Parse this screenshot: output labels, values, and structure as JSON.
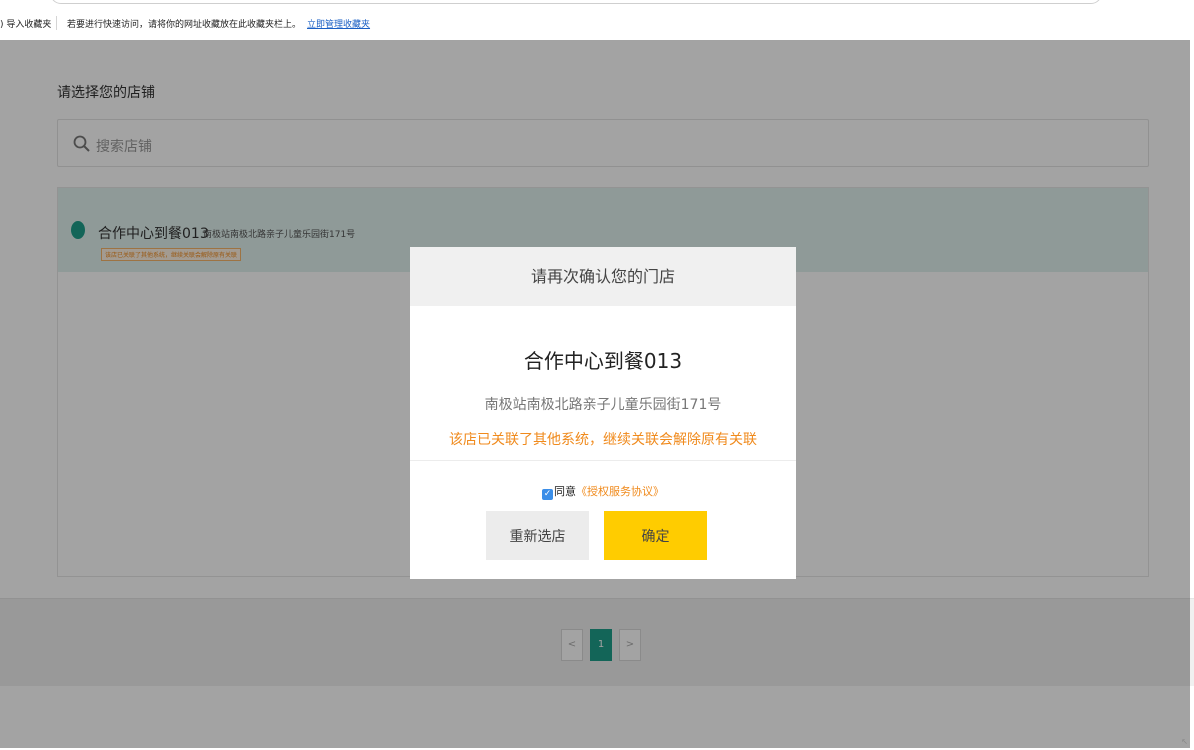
{
  "bookmarks_bar": {
    "import_label": ") 导入收藏夹",
    "message": "若要进行快速访问，请将你的网址收藏放在此收藏夹栏上。",
    "manage_link": "立即管理收藏夹"
  },
  "page": {
    "title": "请选择您的店铺",
    "search_placeholder": "搜索店铺",
    "store": {
      "name": "合作中心到餐013",
      "address": "南极站南极北路亲子儿童乐园街171号",
      "warning_tag": "该店已关联了其他系统，继续关联会解除原有关联"
    },
    "pagination": {
      "prev": "<",
      "current": "1",
      "next": ">"
    }
  },
  "modal": {
    "title": "请再次确认您的门店",
    "store_name": "合作中心到餐013",
    "store_address": "南极站南极北路亲子儿童乐园街171号",
    "warning": "该店已关联了其他系统，继续关联会解除原有关联",
    "agree_label": "同意",
    "agreement_link": "《授权服务协议》",
    "checkbox_checked": true,
    "reselect_button": "重新选店",
    "confirm_button": "确定"
  },
  "colors": {
    "accent": "#1e9e8a",
    "confirm": "#ffcc00",
    "warning": "#f08a1c",
    "link": "#1a5fc4"
  }
}
